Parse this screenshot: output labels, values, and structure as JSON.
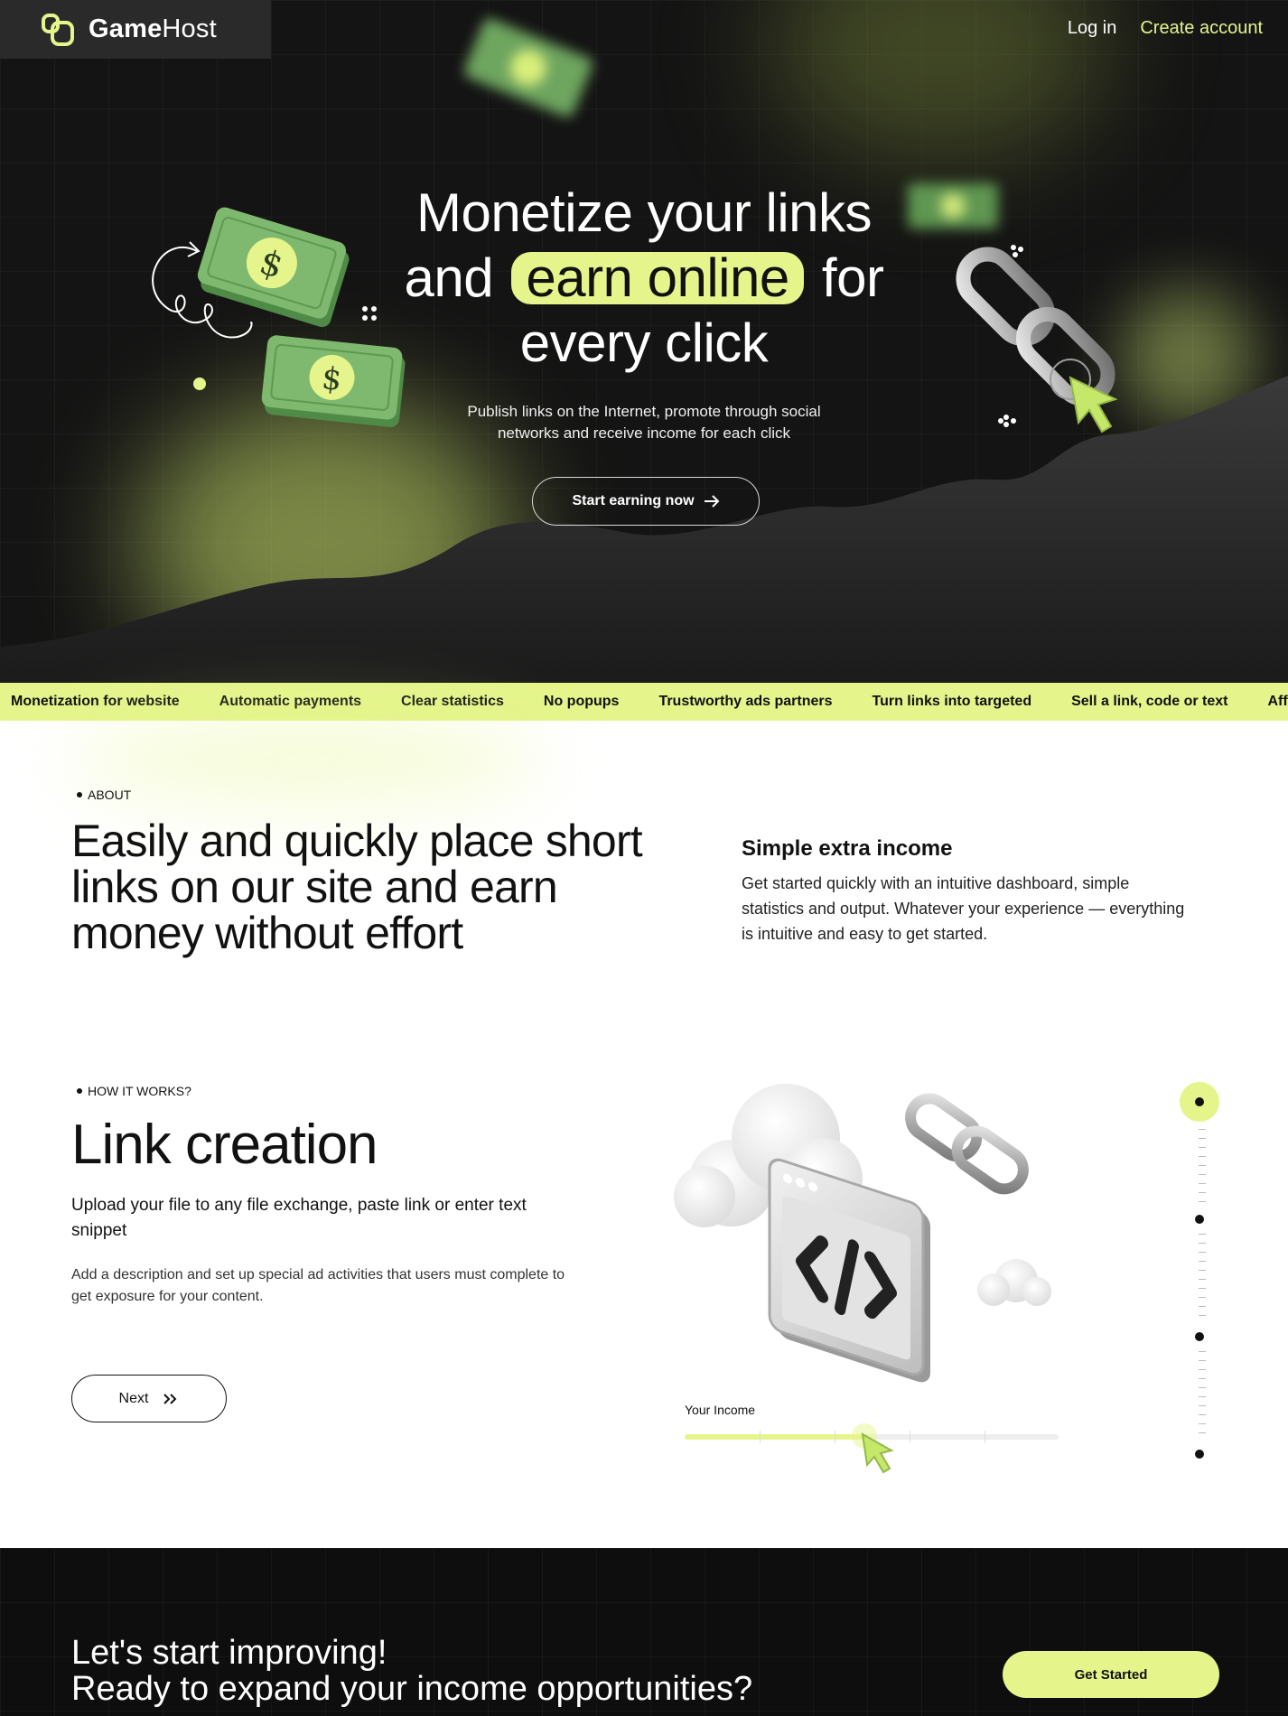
{
  "brand": {
    "name_bold": "Game",
    "name_regular": "Host"
  },
  "nav": {
    "login": "Log in",
    "create_account": "Create account"
  },
  "hero": {
    "title_line1": "Monetize your links",
    "title_line2_pre": "and",
    "title_highlight": "earn online",
    "title_line2_post": "for",
    "title_line3": "every click",
    "subtitle": "Publish links on the Internet, promote through social networks and receive income for each click",
    "cta_label": "Start earning now",
    "cta_icon": "arrow-right-icon",
    "currency_symbol": "$"
  },
  "ticker": {
    "items": [
      "Monetization for website",
      "Automatic payments",
      "Clear statistics",
      "No popups",
      "Trustworthy ads partners",
      "Turn links into targeted",
      "Sell a link, code or text",
      "Affiliate"
    ]
  },
  "about": {
    "eyebrow": "ABOUT",
    "title": "Easily and quickly place short links on our site and earn money without effort",
    "side_title": "Simple extra income",
    "side_text": "Get started quickly with an intuitive dashboard, simple statistics and output. Whatever your experience — everything is intuitive and easy to get started."
  },
  "how": {
    "eyebrow": "HOW IT WORKS?",
    "title": "Link creation",
    "lead": "Upload your file to any file exchange, paste link or enter text snippet",
    "text": "Add a description and set up special ad activities that users must complete to get exposure for your content.",
    "next_label": "Next",
    "next_icon": "double-chevron-right-icon",
    "income_label": "Your Income",
    "income_level": 0.48,
    "steps_total": 4,
    "active_step": 1
  },
  "cta": {
    "line1": "Let's start improving!",
    "line2": "Ready to expand your income opportunities?",
    "button": "Get Started"
  },
  "colors": {
    "accent": "#e5f58c",
    "dark": "#141414",
    "money_green": "#78b26a"
  }
}
